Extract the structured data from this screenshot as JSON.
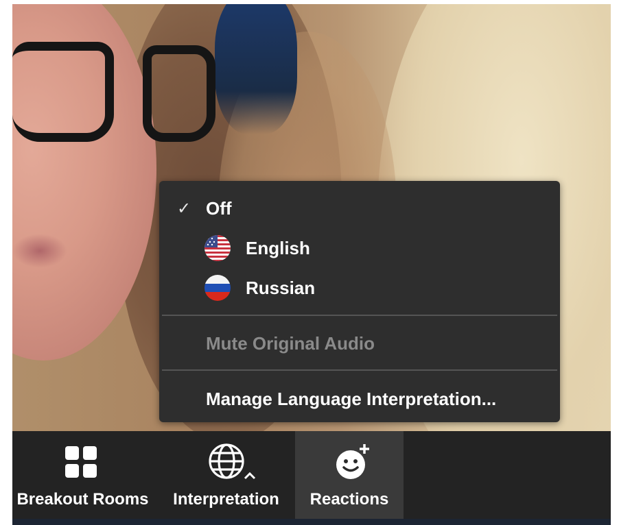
{
  "interpretation_menu": {
    "items": [
      {
        "label": "Off",
        "checked": true,
        "icon": "checkmark-icon"
      },
      {
        "label": "English",
        "checked": false,
        "icon": "us-flag-icon"
      },
      {
        "label": "Russian",
        "checked": false,
        "icon": "russia-flag-icon"
      }
    ],
    "mute_original_audio": "Mute Original Audio",
    "manage": "Manage Language Interpretation..."
  },
  "toolbar": {
    "breakout_rooms": "Breakout Rooms",
    "interpretation": "Interpretation",
    "reactions": "Reactions"
  },
  "colors": {
    "menu_bg": "#2e2e2e",
    "toolbar_bg": "#232323",
    "active_button_bg": "#3a3a3a",
    "disabled_text": "#8a8a8a"
  }
}
